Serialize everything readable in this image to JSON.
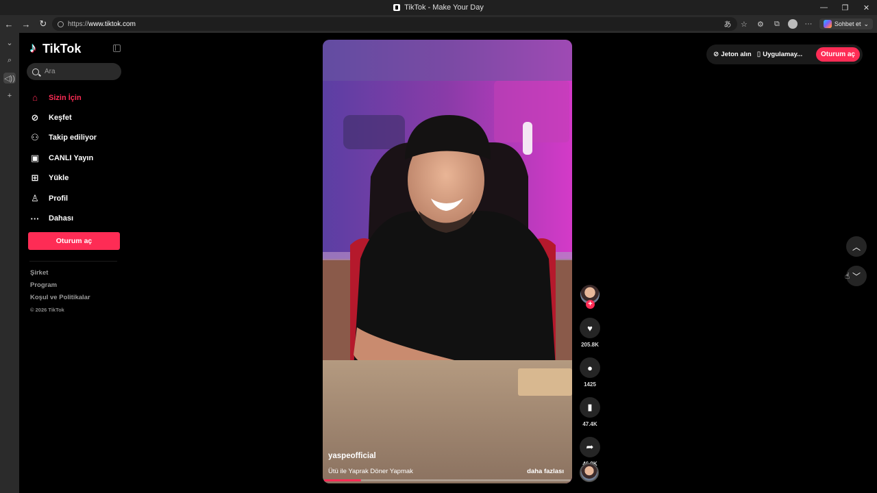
{
  "browser": {
    "title": "TikTok - Make Your Day",
    "url_scheme": "https://",
    "url_host": "www.tiktok.com",
    "copilot_label": "Sohbet et",
    "window_controls": [
      "—",
      "❐",
      "✕"
    ]
  },
  "sidebar": {
    "logo_text": "TikTok",
    "search_placeholder": "Ara",
    "nav": [
      {
        "label": "Sizin İçin",
        "icon": "⌂",
        "icon_name": "home-icon",
        "active": true
      },
      {
        "label": "Keşfet",
        "icon": "⊘",
        "icon_name": "compass-icon"
      },
      {
        "label": "Takip ediliyor",
        "icon": "⚇",
        "icon_name": "following-icon"
      },
      {
        "label": "CANLI Yayın",
        "icon": "▣",
        "icon_name": "live-tv-icon"
      },
      {
        "label": "Yükle",
        "icon": "⊞",
        "icon_name": "upload-icon"
      },
      {
        "label": "Profil",
        "icon": "♙",
        "icon_name": "profile-icon"
      },
      {
        "label": "Dahası",
        "icon": "···",
        "icon_name": "more-icon"
      }
    ],
    "login_label": "Oturum aç",
    "footer": {
      "company": "Şirket",
      "program": "Program",
      "terms": "Koşul ve Politikalar",
      "copyright": "© 2026 TikTok"
    }
  },
  "video": {
    "author": "yaspeofficial",
    "caption": "Ütü ile Yaprak Döner Yapmak",
    "more_label": "daha fazlası",
    "progress": 0.15
  },
  "actions": {
    "likes": "205.8K",
    "comments": "1425",
    "saves": "47.4K",
    "shares": "46.9K"
  },
  "topbar": {
    "coins_label": "Jeton alın",
    "app_label": "Uygulamay...",
    "login_label": "Oturum aç"
  },
  "colors": {
    "accent": "#fe2c55",
    "background": "#000000"
  }
}
